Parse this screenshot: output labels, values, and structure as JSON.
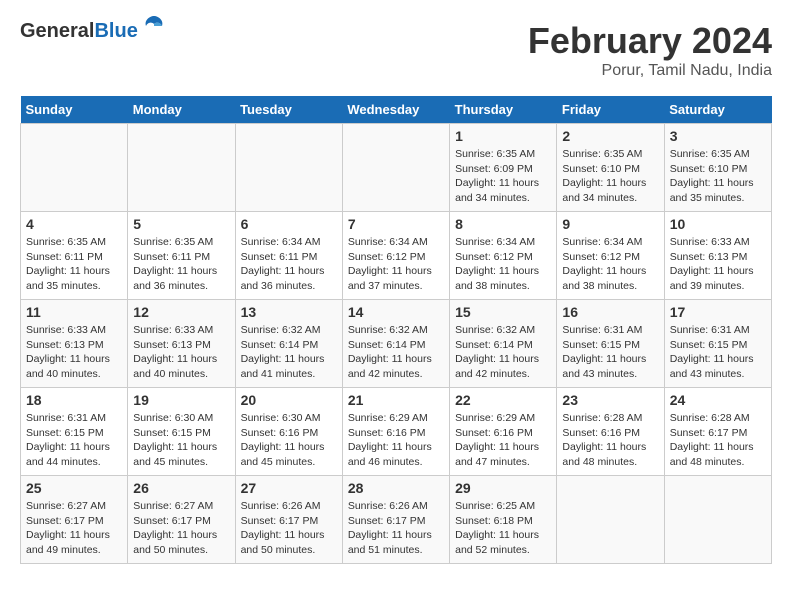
{
  "header": {
    "logo_general": "General",
    "logo_blue": "Blue",
    "month_title": "February 2024",
    "location": "Porur, Tamil Nadu, India"
  },
  "weekdays": [
    "Sunday",
    "Monday",
    "Tuesday",
    "Wednesday",
    "Thursday",
    "Friday",
    "Saturday"
  ],
  "weeks": [
    [
      {
        "day": "",
        "info": ""
      },
      {
        "day": "",
        "info": ""
      },
      {
        "day": "",
        "info": ""
      },
      {
        "day": "",
        "info": ""
      },
      {
        "day": "1",
        "info": "Sunrise: 6:35 AM\nSunset: 6:09 PM\nDaylight: 11 hours and 34 minutes."
      },
      {
        "day": "2",
        "info": "Sunrise: 6:35 AM\nSunset: 6:10 PM\nDaylight: 11 hours and 34 minutes."
      },
      {
        "day": "3",
        "info": "Sunrise: 6:35 AM\nSunset: 6:10 PM\nDaylight: 11 hours and 35 minutes."
      }
    ],
    [
      {
        "day": "4",
        "info": "Sunrise: 6:35 AM\nSunset: 6:11 PM\nDaylight: 11 hours and 35 minutes."
      },
      {
        "day": "5",
        "info": "Sunrise: 6:35 AM\nSunset: 6:11 PM\nDaylight: 11 hours and 36 minutes."
      },
      {
        "day": "6",
        "info": "Sunrise: 6:34 AM\nSunset: 6:11 PM\nDaylight: 11 hours and 36 minutes."
      },
      {
        "day": "7",
        "info": "Sunrise: 6:34 AM\nSunset: 6:12 PM\nDaylight: 11 hours and 37 minutes."
      },
      {
        "day": "8",
        "info": "Sunrise: 6:34 AM\nSunset: 6:12 PM\nDaylight: 11 hours and 38 minutes."
      },
      {
        "day": "9",
        "info": "Sunrise: 6:34 AM\nSunset: 6:12 PM\nDaylight: 11 hours and 38 minutes."
      },
      {
        "day": "10",
        "info": "Sunrise: 6:33 AM\nSunset: 6:13 PM\nDaylight: 11 hours and 39 minutes."
      }
    ],
    [
      {
        "day": "11",
        "info": "Sunrise: 6:33 AM\nSunset: 6:13 PM\nDaylight: 11 hours and 40 minutes."
      },
      {
        "day": "12",
        "info": "Sunrise: 6:33 AM\nSunset: 6:13 PM\nDaylight: 11 hours and 40 minutes."
      },
      {
        "day": "13",
        "info": "Sunrise: 6:32 AM\nSunset: 6:14 PM\nDaylight: 11 hours and 41 minutes."
      },
      {
        "day": "14",
        "info": "Sunrise: 6:32 AM\nSunset: 6:14 PM\nDaylight: 11 hours and 42 minutes."
      },
      {
        "day": "15",
        "info": "Sunrise: 6:32 AM\nSunset: 6:14 PM\nDaylight: 11 hours and 42 minutes."
      },
      {
        "day": "16",
        "info": "Sunrise: 6:31 AM\nSunset: 6:15 PM\nDaylight: 11 hours and 43 minutes."
      },
      {
        "day": "17",
        "info": "Sunrise: 6:31 AM\nSunset: 6:15 PM\nDaylight: 11 hours and 43 minutes."
      }
    ],
    [
      {
        "day": "18",
        "info": "Sunrise: 6:31 AM\nSunset: 6:15 PM\nDaylight: 11 hours and 44 minutes."
      },
      {
        "day": "19",
        "info": "Sunrise: 6:30 AM\nSunset: 6:15 PM\nDaylight: 11 hours and 45 minutes."
      },
      {
        "day": "20",
        "info": "Sunrise: 6:30 AM\nSunset: 6:16 PM\nDaylight: 11 hours and 45 minutes."
      },
      {
        "day": "21",
        "info": "Sunrise: 6:29 AM\nSunset: 6:16 PM\nDaylight: 11 hours and 46 minutes."
      },
      {
        "day": "22",
        "info": "Sunrise: 6:29 AM\nSunset: 6:16 PM\nDaylight: 11 hours and 47 minutes."
      },
      {
        "day": "23",
        "info": "Sunrise: 6:28 AM\nSunset: 6:16 PM\nDaylight: 11 hours and 48 minutes."
      },
      {
        "day": "24",
        "info": "Sunrise: 6:28 AM\nSunset: 6:17 PM\nDaylight: 11 hours and 48 minutes."
      }
    ],
    [
      {
        "day": "25",
        "info": "Sunrise: 6:27 AM\nSunset: 6:17 PM\nDaylight: 11 hours and 49 minutes."
      },
      {
        "day": "26",
        "info": "Sunrise: 6:27 AM\nSunset: 6:17 PM\nDaylight: 11 hours and 50 minutes."
      },
      {
        "day": "27",
        "info": "Sunrise: 6:26 AM\nSunset: 6:17 PM\nDaylight: 11 hours and 50 minutes."
      },
      {
        "day": "28",
        "info": "Sunrise: 6:26 AM\nSunset: 6:17 PM\nDaylight: 11 hours and 51 minutes."
      },
      {
        "day": "29",
        "info": "Sunrise: 6:25 AM\nSunset: 6:18 PM\nDaylight: 11 hours and 52 minutes."
      },
      {
        "day": "",
        "info": ""
      },
      {
        "day": "",
        "info": ""
      }
    ]
  ]
}
